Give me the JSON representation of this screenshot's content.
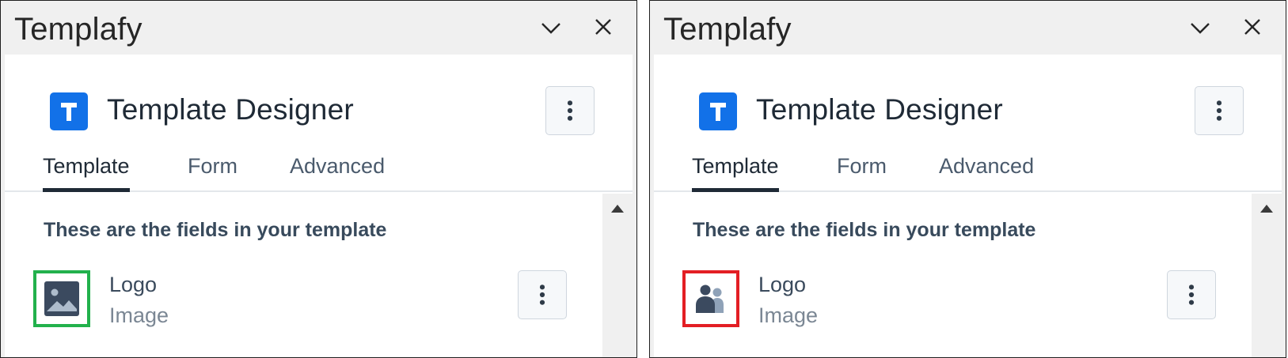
{
  "panels": [
    {
      "window_title": "Templafy",
      "app_title": "Template Designer",
      "tabs": [
        "Template",
        "Form",
        "Advanced"
      ],
      "active_tab": "Template",
      "section_heading": "These are the fields in your template",
      "field": {
        "name": "Logo",
        "type": "Image",
        "icon": "image-icon",
        "highlight_color": "#22b14c"
      }
    },
    {
      "window_title": "Templafy",
      "app_title": "Template Designer",
      "tabs": [
        "Template",
        "Form",
        "Advanced"
      ],
      "active_tab": "Template",
      "section_heading": "These are the fields in your template",
      "field": {
        "name": "Logo",
        "type": "Image",
        "icon": "users-icon",
        "highlight_color": "#e31e24"
      }
    }
  ],
  "colors": {
    "accent": "#1271e8",
    "text_dark": "#1f2a36",
    "active_tab_underline": "#1f2a36"
  }
}
